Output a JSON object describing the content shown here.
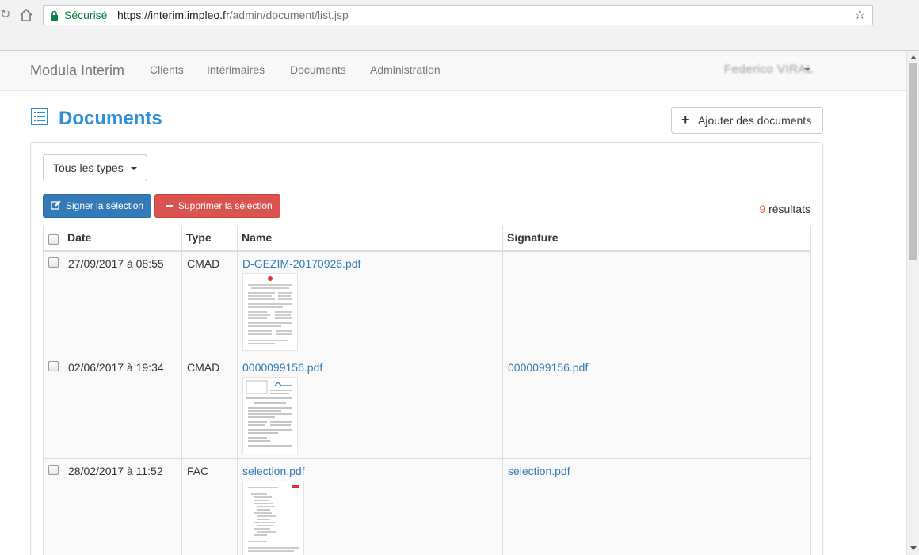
{
  "browser": {
    "secure_label": "Sécurisé",
    "url_host": "https://interim.impleo.fr",
    "url_path": "/admin/document/list.jsp"
  },
  "navbar": {
    "brand": "Modula Interim",
    "links": [
      "Clients",
      "Intérimaires",
      "Documents",
      "Administration"
    ],
    "user": "Federico VIRAL"
  },
  "header": {
    "title": "Documents",
    "add_label": "Ajouter des documents"
  },
  "toolbar": {
    "type_filter": "Tous les types",
    "sign_label": "Signer la sélection",
    "delete_label": "Supprimer la sélection",
    "results_count": "9",
    "results_label": " résultats"
  },
  "table": {
    "columns": [
      "Date",
      "Type",
      "Name",
      "Signature"
    ],
    "rows": [
      {
        "date": "27/09/2017 à 08:55",
        "type": "CMAD",
        "name": "D-GEZIM-20170926.pdf",
        "signature": ""
      },
      {
        "date": "02/06/2017 à 19:34",
        "type": "CMAD",
        "name": "0000099156.pdf",
        "signature": "0000099156.pdf"
      },
      {
        "date": "28/02/2017 à 11:52",
        "type": "FAC",
        "name": "selection.pdf",
        "signature": "selection.pdf"
      }
    ]
  },
  "icons": {
    "reload": "reload-icon",
    "home": "home-icon",
    "lock": "lock-icon",
    "star": "star-icon",
    "list": "list-icon",
    "plus": "plus-icon",
    "edit": "edit-icon",
    "minus": "minus-icon"
  },
  "colors": {
    "title": "#2f8fd8",
    "primary": "#337ab7",
    "danger": "#d9534f",
    "secure": "#0b8043",
    "result_count": "#e8632c"
  }
}
